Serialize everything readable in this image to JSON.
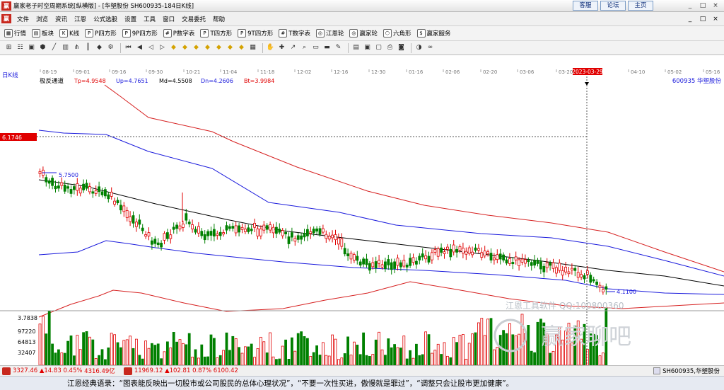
{
  "window": {
    "logo": "赢",
    "title": "赢家老子时空周期系统[纵横版] - [华塑股份  SH600935-184日K线]",
    "top_links": [
      "客服",
      "论坛",
      "主页"
    ],
    "controls": [
      "_",
      "□",
      "×"
    ]
  },
  "menu": {
    "items": [
      "文件",
      "浏览",
      "资讯",
      "江恩",
      "公式选股",
      "设置",
      "工具",
      "窗口",
      "交易委托",
      "帮助"
    ],
    "controls": [
      "_",
      "□",
      "×"
    ]
  },
  "toolbar1": {
    "items": [
      {
        "label": "行情",
        "icon": "grid-icon"
      },
      {
        "label": "板块",
        "icon": "block-icon"
      },
      {
        "label": "K线",
        "icon": "kline-icon"
      },
      {
        "label": "P四方形",
        "icon": "square-icon"
      },
      {
        "label": "9P四方形",
        "icon": "square-icon"
      },
      {
        "label": "P数字表",
        "icon": "table-icon"
      },
      {
        "label": "T四方形",
        "icon": "square-icon"
      },
      {
        "label": "9T四方形",
        "icon": "square-icon"
      },
      {
        "label": "T数字表",
        "icon": "table-icon"
      },
      {
        "label": "江恩轮",
        "icon": "wheel-icon"
      },
      {
        "label": "赢家轮",
        "icon": "wheel-icon"
      },
      {
        "label": "六角形",
        "icon": "hexagon-icon"
      },
      {
        "label": "赢家服务",
        "icon": "dollar-icon"
      }
    ]
  },
  "toolbar2": {
    "icons": [
      "pointer-icon",
      "chart-icon",
      "rect-icon",
      "hex-icon",
      "line-icon",
      "bar-icon",
      "fork-icon",
      "candle-icon",
      "drop-icon",
      "gear-icon",
      "sep",
      "start-icon",
      "prev-icon",
      "left-icon",
      "right-icon",
      "diamond-icon",
      "diamond-icon",
      "diamond-icon",
      "diamond-icon",
      "diamond-icon",
      "diamond-icon",
      "diamond-icon",
      "grid-icon",
      "sep",
      "hand-icon",
      "cross-icon",
      "arrow-icon",
      "zoom-icon",
      "ruler-icon",
      "eraser-icon",
      "brush-icon",
      "sep",
      "calc-icon",
      "save-icon",
      "doc-icon",
      "print-icon",
      "camera-icon",
      "sep",
      "color-icon",
      "link-icon"
    ]
  },
  "chart_header": {
    "period_label": "日K线",
    "indicator_name": "极反通道",
    "tp": "Tp=4.9548",
    "up": "Up=4.7651",
    "md": "Md=4.5508",
    "dn": "Dn=4.2606",
    "bt": "Bt=3.9984",
    "stock": "600935 华塑股份"
  },
  "chart_data": {
    "type": "candlestick",
    "x_ticks": [
      "08-19",
      "09-01",
      "09-16",
      "09-30",
      "10-21",
      "11-04",
      "11-18",
      "12-02",
      "12-16",
      "12-30",
      "01-16",
      "02-06",
      "02-20",
      "03-06",
      "03-20",
      "04-10",
      "05-02",
      "05-16"
    ],
    "cursor_date": "2023-03-29",
    "price_marker": "6.1746",
    "high_label": "5.7500",
    "low_label": "4.1100",
    "volume_floor": "3.7838",
    "volume_ticks": [
      "97220",
      "64813",
      "32407"
    ],
    "ylim": [
      3.7838,
      6.33
    ],
    "colors": {
      "up": "#e00000",
      "down": "#008000",
      "mid": "#000000",
      "inner_band": "#1a1adc",
      "outer_band": "#d62020",
      "cursor": "#000000",
      "marker_bg": "#e00000"
    }
  },
  "watermark": {
    "qq": "江恩工具软件  QQ:100800360",
    "brand": "赢家聊吧"
  },
  "status": {
    "sh_index": "3327.46",
    "sh_change": "▲14.83",
    "sh_pct": "0.45%",
    "sh_amount": "4316.49亿",
    "sz_index": "11969.12",
    "sz_change": "▲102.81",
    "sz_pct": "0.87%",
    "sz_amount": "6100.42",
    "stock": "SH600935,华塑股份"
  },
  "quote": "江恩经典语录：“图表能反映出一切股市或公司股民的总体心理状况”，“不要一次性买进，傲慢就是罪过”，“调整只会让股市更加健康”。"
}
